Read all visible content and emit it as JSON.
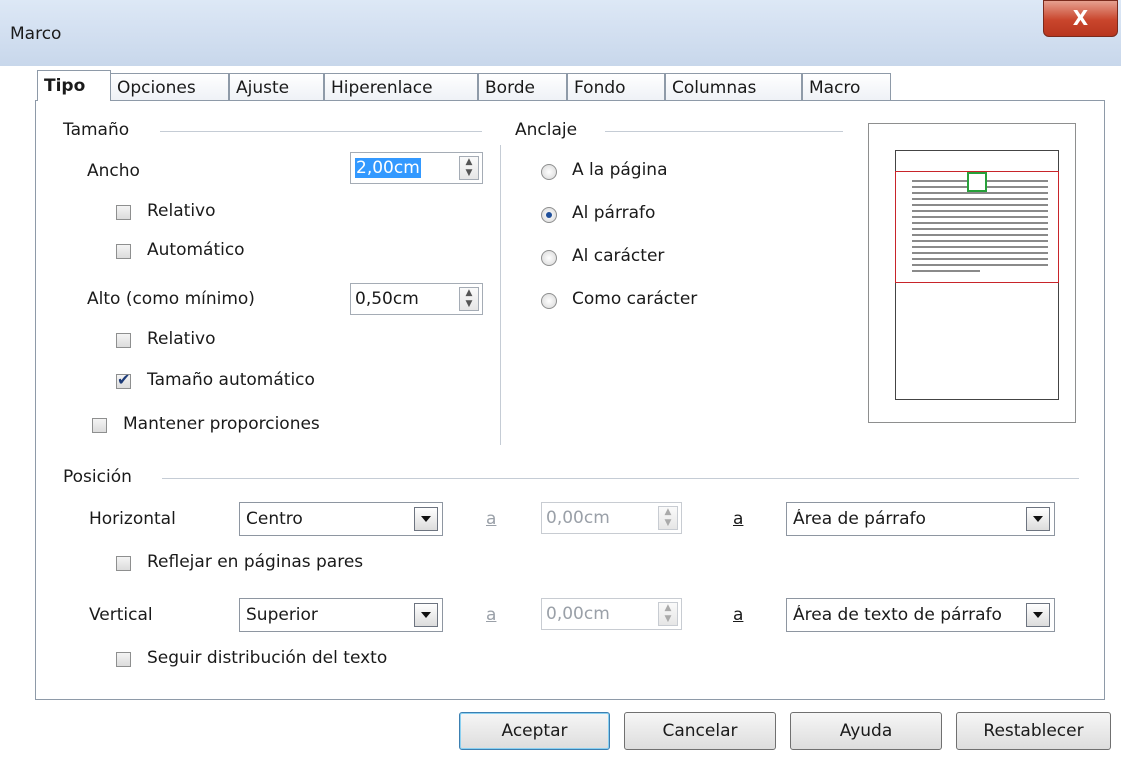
{
  "window": {
    "title": "Marco",
    "close_label": "X"
  },
  "tabs": [
    {
      "label": "Tipo",
      "active": true
    },
    {
      "label": "Opciones"
    },
    {
      "label": "Ajuste"
    },
    {
      "label": "Hiperenlace"
    },
    {
      "label": "Borde"
    },
    {
      "label": "Fondo"
    },
    {
      "label": "Columnas"
    },
    {
      "label": "Macro"
    }
  ],
  "size": {
    "group": "Tamaño",
    "width_label": "Ancho",
    "width_value": "2,00cm",
    "width_relative": {
      "label": "Relativo",
      "checked": false
    },
    "width_auto": {
      "label": "Automático",
      "checked": false
    },
    "height_label": "Alto (como mínimo)",
    "height_value": "0,50cm",
    "height_relative": {
      "label": "Relativo",
      "checked": false
    },
    "height_auto": {
      "label": "Tamaño automático",
      "checked": true
    },
    "keep_ratio": {
      "label": "Mantener proporciones",
      "checked": false
    }
  },
  "anchor": {
    "group": "Anclaje",
    "options": [
      {
        "label": "A la página",
        "selected": false
      },
      {
        "label": "Al párrafo",
        "selected": true
      },
      {
        "label": "Al carácter",
        "selected": false
      },
      {
        "label": "Como carácter",
        "selected": false
      }
    ]
  },
  "position": {
    "group": "Posición",
    "horizontal_label": "Horizontal",
    "horizontal_value": "Centro",
    "h_by_label": "a",
    "h_offset": "0,00cm",
    "h_to_label": "a",
    "h_to_value": "Área de párrafo",
    "mirror": {
      "label": "Reflejar en páginas pares",
      "checked": false
    },
    "vertical_label": "Vertical",
    "vertical_value": "Superior",
    "v_by_label": "a",
    "v_offset": "0,00cm",
    "v_to_label": "a",
    "v_to_value": "Área de texto de párrafo",
    "follow_flow": {
      "label": "Seguir distribución del texto",
      "checked": false
    }
  },
  "buttons": {
    "ok": "Aceptar",
    "cancel": "Cancelar",
    "help": "Ayuda",
    "reset": "Restablecer"
  }
}
